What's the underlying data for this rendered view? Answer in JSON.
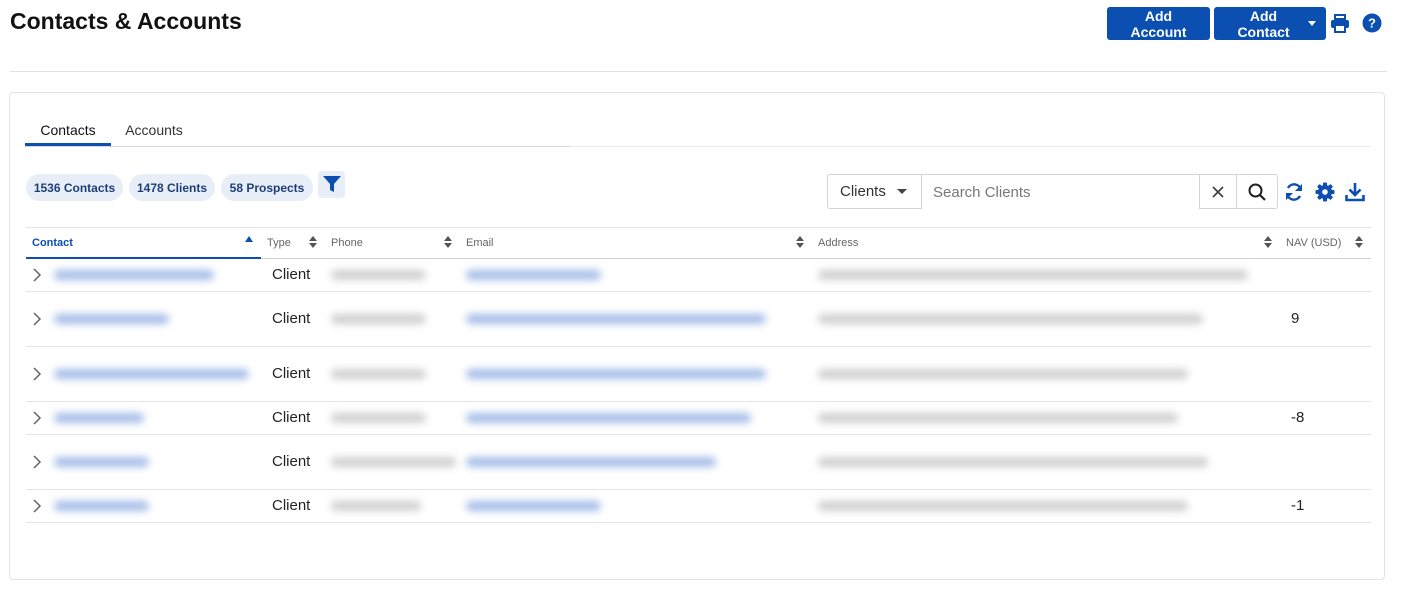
{
  "header": {
    "title": "Contacts & Accounts",
    "add_account_label": "Add Account",
    "add_contact_label": "Add Contact",
    "print_icon": "print-icon",
    "help_icon": "help-icon"
  },
  "tabs": [
    {
      "label": "Contacts",
      "active": true
    },
    {
      "label": "Accounts",
      "active": false
    }
  ],
  "chips": [
    {
      "label": "1536 Contacts"
    },
    {
      "label": "1478 Clients"
    },
    {
      "label": "58 Prospects"
    }
  ],
  "search": {
    "scope_value": "Clients",
    "placeholder": "Search Clients"
  },
  "table": {
    "columns": [
      {
        "label": "Contact",
        "sorted": "asc"
      },
      {
        "label": "Type"
      },
      {
        "label": "Phone"
      },
      {
        "label": "Email"
      },
      {
        "label": "Address"
      },
      {
        "label": "NAV (USD)"
      }
    ],
    "rows": [
      {
        "type": "Client",
        "nav": ""
      },
      {
        "type": "Client",
        "nav": "9"
      },
      {
        "type": "Client",
        "nav": ""
      },
      {
        "type": "Client",
        "nav": "-8"
      },
      {
        "type": "Client",
        "nav": ""
      },
      {
        "type": "Client",
        "nav": "-1"
      }
    ]
  },
  "colors": {
    "accent": "#0b4fb0",
    "chip_bg": "#e8eef7"
  }
}
